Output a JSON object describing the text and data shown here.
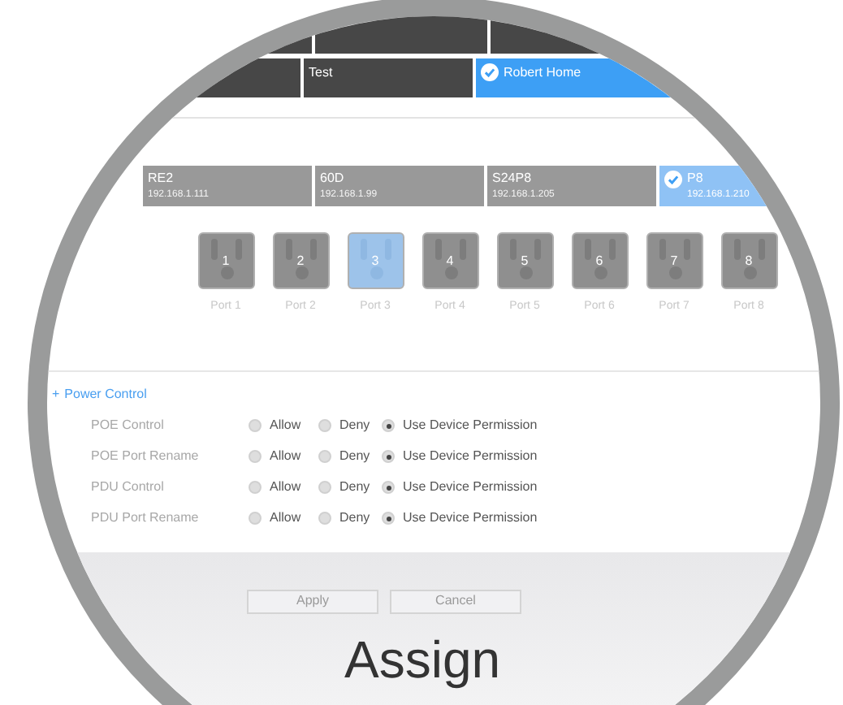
{
  "groups": [
    {
      "selected": false
    },
    {
      "name": "Test",
      "selected": false
    },
    {
      "name": "Robert Home",
      "selected": true
    }
  ],
  "devices": [
    {
      "name": "RE2",
      "ip": "192.168.1.111",
      "selected": false
    },
    {
      "name": "60D",
      "ip": "192.168.1.99",
      "selected": false
    },
    {
      "name": "S24P8",
      "ip": "192.168.1.205",
      "selected": false
    },
    {
      "name": "P8",
      "ip": "192.168.1.210",
      "selected": true
    }
  ],
  "ports": [
    {
      "number": "1",
      "label": "Port 1",
      "selected": false
    },
    {
      "number": "2",
      "label": "Port 2",
      "selected": false
    },
    {
      "number": "3",
      "label": "Port 3",
      "selected": true
    },
    {
      "number": "4",
      "label": "Port 4",
      "selected": false
    },
    {
      "number": "5",
      "label": "Port 5",
      "selected": false
    },
    {
      "number": "6",
      "label": "Port 6",
      "selected": false
    },
    {
      "number": "7",
      "label": "Port 7",
      "selected": false
    },
    {
      "number": "8",
      "label": "Port 8",
      "selected": false
    }
  ],
  "section": {
    "toggle": "+",
    "title": "Power Control"
  },
  "permissions": [
    {
      "label": "POE Control",
      "options": [
        {
          "label": "Allow",
          "selected": false
        },
        {
          "label": "Deny",
          "selected": false
        },
        {
          "label": "Use Device Permission",
          "selected": true
        }
      ]
    },
    {
      "label": "POE Port Rename",
      "options": [
        {
          "label": "Allow",
          "selected": false
        },
        {
          "label": "Deny",
          "selected": false
        },
        {
          "label": "Use Device Permission",
          "selected": true
        }
      ]
    },
    {
      "label": "PDU Control",
      "options": [
        {
          "label": "Allow",
          "selected": false
        },
        {
          "label": "Deny",
          "selected": false
        },
        {
          "label": "Use Device Permission",
          "selected": true
        }
      ]
    },
    {
      "label": "PDU Port Rename",
      "options": [
        {
          "label": "Allow",
          "selected": false
        },
        {
          "label": "Deny",
          "selected": false
        },
        {
          "label": "Use Device Permission",
          "selected": true
        }
      ]
    }
  ],
  "buttons": [
    "Apply",
    "Cancel"
  ],
  "heading": "Assign"
}
